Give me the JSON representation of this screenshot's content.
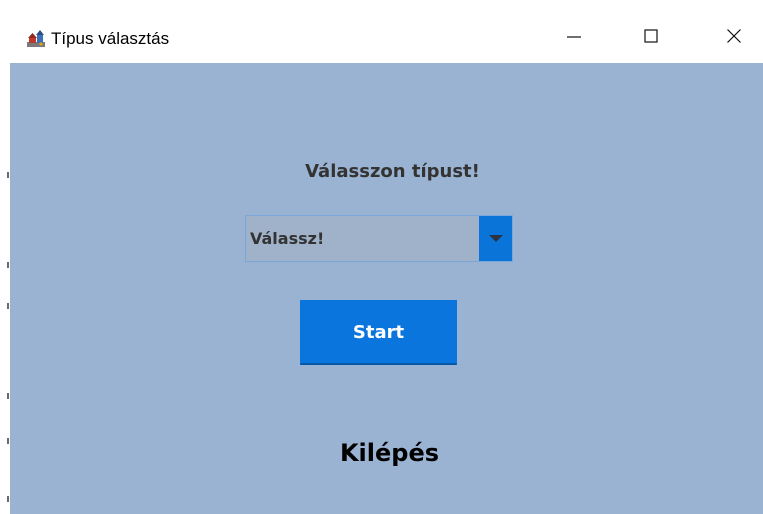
{
  "window": {
    "title": "Típus választás"
  },
  "main": {
    "heading": "Válasszon típust!",
    "type_select": {
      "selected": "Válassz!"
    },
    "start_label": "Start",
    "exit_label": "Kilépés"
  },
  "colors": {
    "client_background": "#9ab3d2",
    "accent": "#0a76dd",
    "combo_background": "#9fb2c9"
  },
  "icons": {
    "app": "app-icon",
    "minimize": "minimize-icon",
    "maximize": "maximize-icon",
    "close": "close-icon",
    "dropdown": "chevron-down-icon"
  }
}
